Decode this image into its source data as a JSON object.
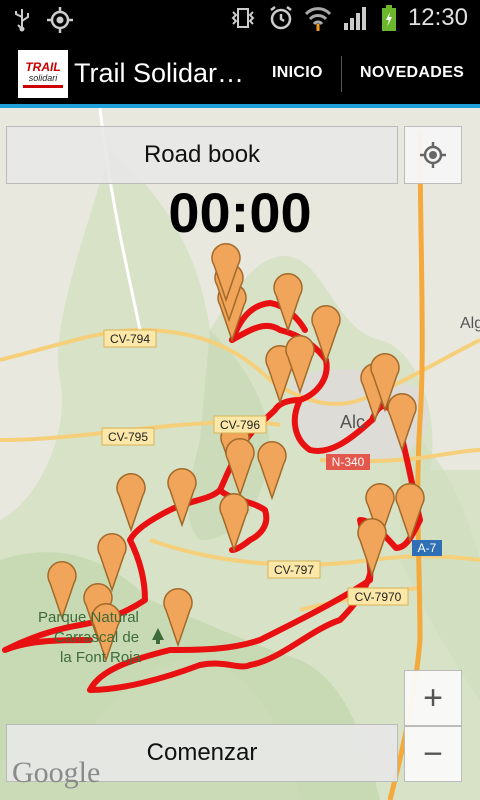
{
  "status_bar": {
    "time": "12:30"
  },
  "action_bar": {
    "logo_line1": "TRAIL",
    "logo_line2": "solidari",
    "title": "Trail Solidar…",
    "inicio": "INICIO",
    "novedades": "NOVEDADES"
  },
  "controls": {
    "road_book": "Road book",
    "timer": "00:00",
    "comenzar": "Comenzar",
    "zoom_in": "+",
    "zoom_out": "−"
  },
  "map": {
    "road_labels": [
      "CV-794",
      "CV-795",
      "CV-796",
      "CV-797",
      "CV-7970",
      "N-340",
      "A-7"
    ],
    "place_labels": [
      "Alc",
      "Alg",
      "Parque Natural",
      "Carrascal de",
      "la Font Roja"
    ],
    "attribution": "Google",
    "route_color": "#e81010",
    "marker_color": "#f0a55a"
  }
}
